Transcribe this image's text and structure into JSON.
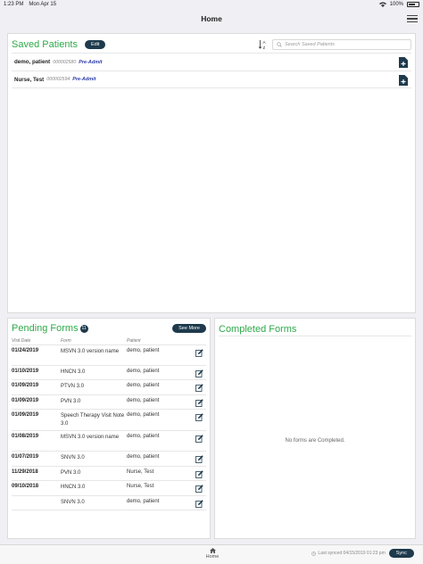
{
  "status_bar": {
    "time": "1:23 PM",
    "date": "Mon Apr 15",
    "battery": "100%"
  },
  "nav": {
    "title": "Home"
  },
  "saved_patients": {
    "title": "Saved Patients",
    "edit_label": "Edit",
    "search_placeholder": "Search Saved Patients",
    "patients": [
      {
        "name": "demo, patient",
        "id": "000002580",
        "status": "Pre-Admit"
      },
      {
        "name": "Nurse, Test",
        "id": "000002594",
        "status": "Pre-Admit"
      }
    ]
  },
  "pending_forms": {
    "title": "Pending Forms",
    "count": "11",
    "see_more_label": "See More",
    "columns": {
      "date": "Visit Date",
      "form": "Form",
      "patient": "Patient"
    },
    "rows": [
      {
        "date": "01/24/2019",
        "form": "MSVN 3.0 version name",
        "patient": "demo, patient"
      },
      {
        "date": "01/10/2019",
        "form": "HNCN 3.0",
        "patient": "demo, patient"
      },
      {
        "date": "01/09/2019",
        "form": "PTVN 3.0",
        "patient": "demo, patient"
      },
      {
        "date": "01/09/2019",
        "form": "PVN 3.0",
        "patient": "demo, patient"
      },
      {
        "date": "01/09/2019",
        "form": "Speech Therapy Visit Note 3.0",
        "patient": "demo, patient"
      },
      {
        "date": "01/08/2019",
        "form": "MSVN 3.0 version name",
        "patient": "demo, patient"
      },
      {
        "date": "01/07/2019",
        "form": "SNVN 3.0",
        "patient": "demo, patient"
      },
      {
        "date": "11/29/2018",
        "form": "PVN 3.0",
        "patient": "Nurse, Test"
      },
      {
        "date": "09/10/2018",
        "form": "HNCN 3.0",
        "patient": "Nurse, Test"
      },
      {
        "date": "",
        "form": "SNVN 3.0",
        "patient": "demo, patient"
      }
    ]
  },
  "completed_forms": {
    "title": "Completed Forms",
    "empty_message": "No forms are Completed."
  },
  "tab_bar": {
    "home_label": "Home",
    "last_synced": "Last synced 04/15/2019 01:23 pm",
    "sync_label": "Sync"
  },
  "colors": {
    "accent_green": "#2eaa4a",
    "button_dark": "#1e3a4c",
    "status_blue": "#2b3aa8"
  }
}
